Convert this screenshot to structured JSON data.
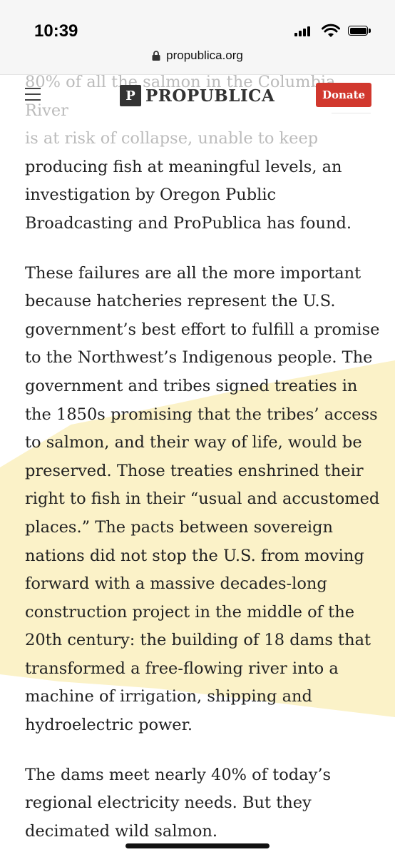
{
  "status_bar": {
    "time": "10:39"
  },
  "browser": {
    "url": "propublica.org"
  },
  "site_header": {
    "logo_mark": "P",
    "logo_text": "PROPUBLICA",
    "donate_label": "Donate"
  },
  "article": {
    "paragraph_1_lines": [
      "80% of all the salmon in the Columbia River",
      "is at risk of collapse, unable to keep",
      "producing fish at meaningful levels, an",
      "investigation by Oregon Public",
      "Broadcasting and ProPublica has found."
    ],
    "paragraph_2": "These failures are all the more important because hatcheries represent the U.S. government’s best effort to fulfill a promise to the Northwest’s Indigenous people. The government and tribes signed treaties in the 1850s promising that the tribes’ access to salmon, and their way of life, would be preserved. Those treaties enshrined their right to fish in their “usual and accustomed places.” The pacts between sovereign nations did not stop the U.S. from moving forward with a massive decades-long construction project in the middle of the 20th century: the building of 18 dams that transformed a free-flowing river into a machine of irrigation, shipping and hydroelectric power.",
    "paragraph_3": "The dams meet nearly 40% of today’s regional electricity needs. But they decimated wild salmon."
  },
  "colors": {
    "donate": "#d1382e",
    "highlight": "#fbf2c8"
  }
}
